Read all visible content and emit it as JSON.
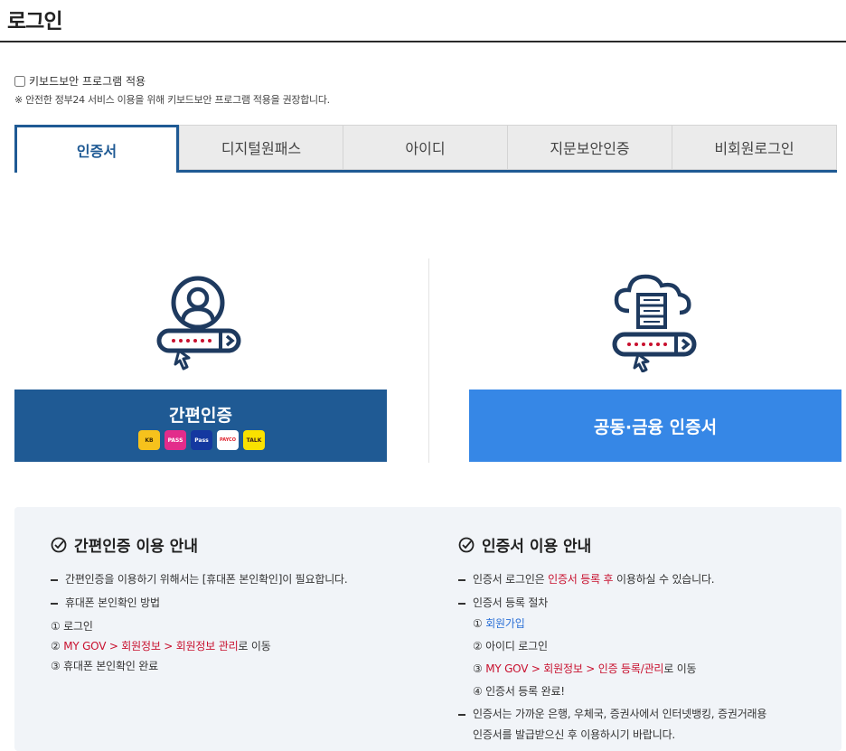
{
  "page": {
    "title": "로그인"
  },
  "keyboard": {
    "checkbox_label": "키보드보안 프로그램 적용",
    "note": "※ 안전한 정부24 서비스 이용을 위해 키보드보안 프로그램 적용을 권장합니다."
  },
  "tabs": [
    {
      "label": "인증서",
      "active": true
    },
    {
      "label": "디지털원패스",
      "active": false
    },
    {
      "label": "아이디",
      "active": false
    },
    {
      "label": "지문보안인증",
      "active": false
    },
    {
      "label": "비회원로그인",
      "active": false
    }
  ],
  "login_options": {
    "easy": {
      "label": "간편인증",
      "color": "#1f5a94",
      "badges": [
        "KB",
        "PASS",
        "Pass",
        "PAYCO",
        "TALK"
      ]
    },
    "cert": {
      "label": "공동·금융 인증서",
      "color": "#3687e6"
    }
  },
  "info_easy": {
    "title": "간편인증 이용 안내",
    "bullet1": "간편인증을 이용하기 위해서는 [휴대폰 본인확인]이 필요합니다.",
    "bullet2": "휴대폰 본인확인 방법",
    "step1": "① 로그인",
    "step2_prefix": "② ",
    "step2_path": "MY GOV > 회원정보 > 회원정보 관리",
    "step2_suffix": "로 이동",
    "step3": "③ 휴대폰 본인확인 완료"
  },
  "info_cert": {
    "title": "인증서 이용 안내",
    "bullet1_prefix": "인증서 로그인은 ",
    "bullet1_highlight": "인증서 등록 후",
    "bullet1_suffix": " 이용하실 수 있습니다.",
    "bullet2": "인증서 등록 절차",
    "step1_prefix": "① ",
    "step1_link": "회원가입",
    "step2": "② 아이디 로그인",
    "step3_prefix": "③ ",
    "step3_path": "MY GOV > 회원정보 > 인증 등록/관리",
    "step3_suffix": "로 이동",
    "step4": "④ 인증서 등록 완료!",
    "bullet3_line1": "인증서는 가까운 은행, 우체국, 증권사에서 인터넷뱅킹, 증권거래용",
    "bullet3_line2": "인증서를 발급받으신 후 이용하시기 바랍니다."
  }
}
